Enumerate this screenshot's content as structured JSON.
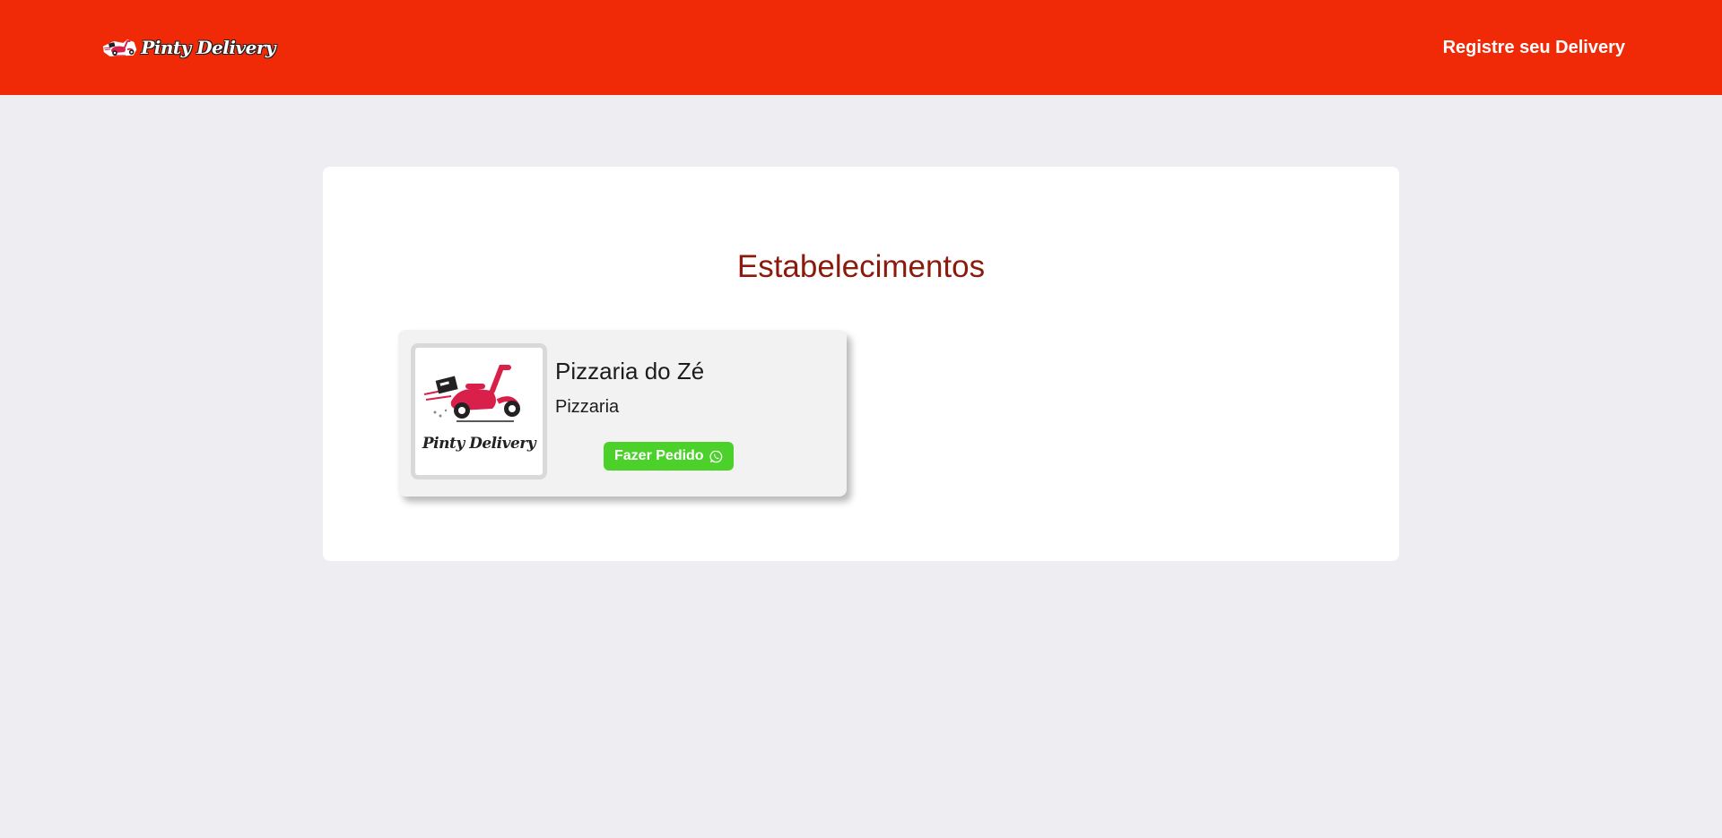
{
  "header": {
    "brand_text": "Pinty Delivery",
    "brand_icon": "delivery-scooter-logo",
    "register_label": "Registre seu Delivery",
    "background_color": "#F02A06"
  },
  "main": {
    "title": "Estabelecimentos",
    "title_color": "#8B1A0C",
    "establishments": [
      {
        "name": "Pizzaria do Zé",
        "category": "Pizzaria",
        "logo_text": "Pinty Delivery",
        "logo_icon": "delivery-scooter-logo",
        "order_label": "Fazer Pedido",
        "order_icon": "whatsapp-icon",
        "order_button_color": "#4CD12A"
      }
    ]
  }
}
